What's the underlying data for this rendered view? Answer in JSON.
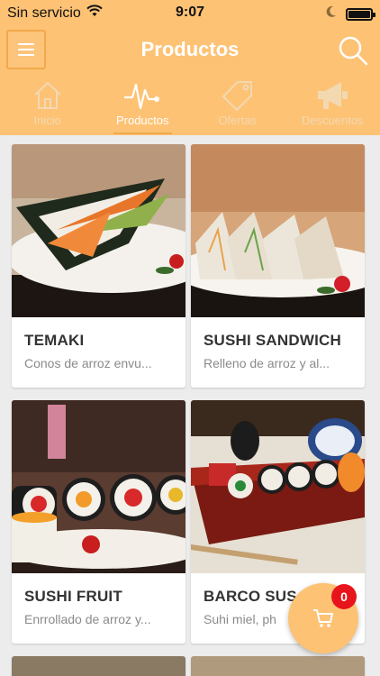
{
  "status": {
    "carrier": "Sin servicio",
    "time": "9:07"
  },
  "header": {
    "title": "Productos"
  },
  "tabs": [
    {
      "label": "Inicio",
      "icon": "home-icon",
      "active": false
    },
    {
      "label": "Productos",
      "icon": "pulse-icon",
      "active": true
    },
    {
      "label": "Ofertas",
      "icon": "tag-icon",
      "active": false
    },
    {
      "label": "Descuentos",
      "icon": "megaphone-icon",
      "active": false
    }
  ],
  "products": [
    {
      "name": "TEMAKI",
      "description": "Conos de arroz envu..."
    },
    {
      "name": "SUSHI SANDWICH",
      "description": "Relleno de arroz y al..."
    },
    {
      "name": "SUSHI FRUIT",
      "description": "Enrrollado de arroz y..."
    },
    {
      "name": "BARCO SUS",
      "description": "Suhi miel, ph"
    }
  ],
  "cart": {
    "count": "0",
    "icon": "cart-icon"
  },
  "colors": {
    "accent": "#fdc274",
    "accent_dark": "#f2a94a",
    "badge": "#e8141b"
  }
}
